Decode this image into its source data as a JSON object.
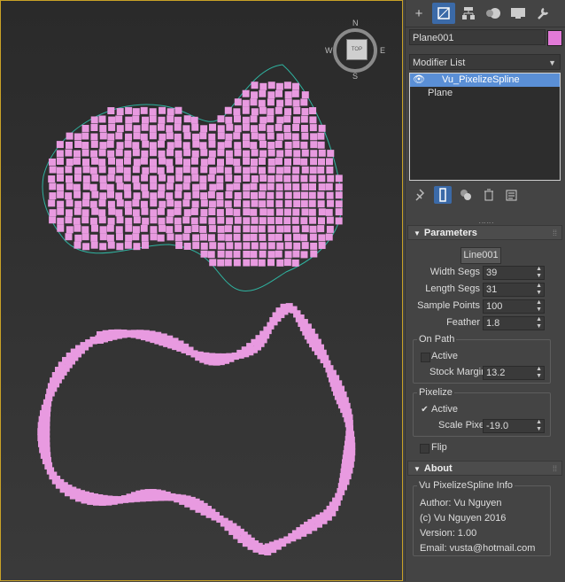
{
  "viewport": {
    "compass": {
      "north": "N",
      "south": "S",
      "east": "E",
      "west": "W",
      "cube_label": "TOP"
    }
  },
  "command_panel": {
    "tabs": [
      {
        "name": "create",
        "icon": "plus-icon"
      },
      {
        "name": "modify",
        "icon": "modify-icon",
        "active": true
      },
      {
        "name": "hierarchy",
        "icon": "hierarchy-icon"
      },
      {
        "name": "motion",
        "icon": "motion-icon"
      },
      {
        "name": "display",
        "icon": "display-icon"
      },
      {
        "name": "utilities",
        "icon": "wrench-icon"
      }
    ],
    "object_name": "Plane001",
    "object_color": "#e27ad8",
    "modifier_list_label": "Modifier List",
    "stack": [
      "Vu_PixelizeSpline",
      "Plane"
    ],
    "stack_tools": [
      "pin-stack-icon",
      "show-end-result-icon",
      "make-unique-icon",
      "remove-modifier-icon",
      "configure-modifier-sets-icon"
    ]
  },
  "parameters": {
    "title": "Parameters",
    "spline_button": "Line001",
    "width_segs": {
      "label": "Width Segs",
      "value": "39"
    },
    "length_segs": {
      "label": "Length Segs",
      "value": "31"
    },
    "sample_points": {
      "label": "Sample Points",
      "value": "100"
    },
    "feather": {
      "label": "Feather",
      "value": "1.8"
    },
    "on_path": {
      "title": "On Path",
      "active_label": "Active",
      "active_checked": false,
      "stock_margin": {
        "label": "Stock Margin",
        "value": "13.2"
      }
    },
    "pixelize": {
      "title": "Pixelize",
      "active_label": "Active",
      "active_checked": true,
      "scale_pixel": {
        "label": "Scale Pixel",
        "value": "-19.0"
      }
    },
    "flip_label": "Flip",
    "flip_checked": false
  },
  "about": {
    "title": "About",
    "group_title": "Vu PixelizeSpline Info",
    "author": "Author: Vu Nguyen",
    "copyright": "(c) Vu Nguyen 2016",
    "version": "Version: 1.00",
    "email": "Email: vusta@hotmail.com"
  },
  "colors": {
    "pixel": "#e89ae0",
    "spline_teal": "#2fb3a0",
    "spline_green": "#a6c98a",
    "selection": "#5a8fd6",
    "accent": "#3b6aa8"
  }
}
